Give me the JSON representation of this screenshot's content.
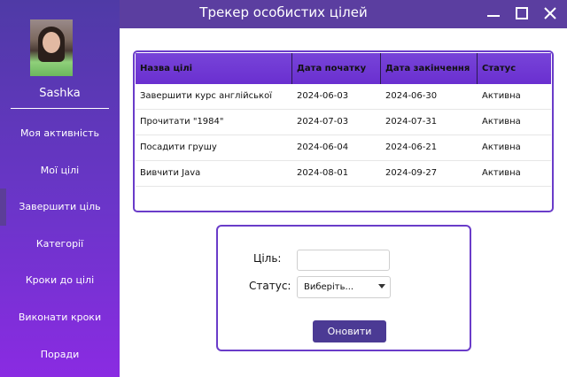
{
  "window": {
    "title": "Трекер особистих цілей"
  },
  "sidebar": {
    "username": "Sashka",
    "items": [
      {
        "label": "Моя активність"
      },
      {
        "label": "Мої цілі"
      },
      {
        "label": "Завершити ціль"
      },
      {
        "label": "Категорії"
      },
      {
        "label": "Кроки до цілі"
      },
      {
        "label": "Виконати кроки"
      },
      {
        "label": "Поради"
      }
    ]
  },
  "table": {
    "columns": [
      "Назва цілі",
      "Дата початку",
      "Дата закінчення",
      "Статус"
    ],
    "rows": [
      [
        "Завершити курс англійської",
        "2024-06-03",
        "2024-06-30",
        "Активна"
      ],
      [
        "Прочитати \"1984\"",
        "2024-07-03",
        "2024-07-31",
        "Активна"
      ],
      [
        "Посадити грушу",
        "2024-06-04",
        "2024-06-21",
        "Активна"
      ],
      [
        "Вивчити Java",
        "2024-08-01",
        "2024-09-27",
        "Активна"
      ]
    ]
  },
  "form": {
    "goal_label": "Ціль:",
    "goal_value": "",
    "status_label": "Статус:",
    "status_selected": "Виберіть...",
    "submit_label": "Оновити"
  }
}
